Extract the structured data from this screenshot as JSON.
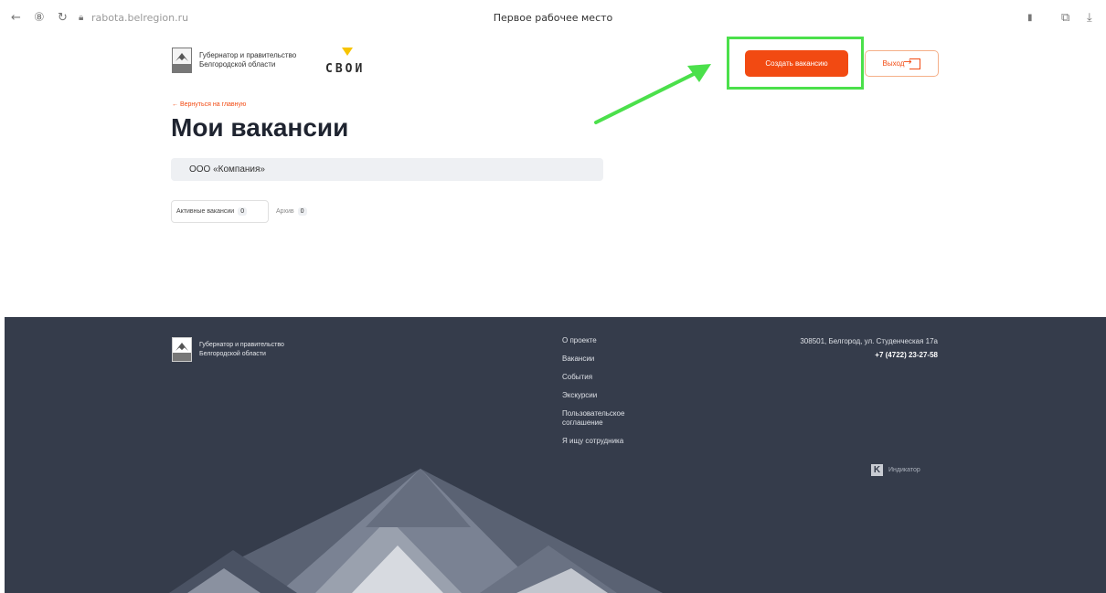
{
  "browser": {
    "url": "rabota.belregion.ru",
    "title": "Первое рабочее место"
  },
  "header": {
    "gov_logo_line1": "Губернатор и правительство",
    "gov_logo_line2": "Белгородской области",
    "svoi_logo_text": "СВОИ",
    "create_button": "Создать вакансию",
    "exit_button": "Выход"
  },
  "main": {
    "back_link": "← Вернуться на главную",
    "title": "Мои вакансии",
    "company": "ООО «Компания»",
    "tabs": [
      {
        "label": "Активные вакансии",
        "count": "0"
      },
      {
        "label": "Архив",
        "count": "0"
      }
    ]
  },
  "footer": {
    "logo_line1": "Губернатор и правительство",
    "logo_line2": "Белгородской области",
    "nav": [
      "О проекте",
      "Вакансии",
      "События",
      "Экскурсии",
      "Пользовательское соглашение",
      "Я ищу сотрудника"
    ],
    "address": "308501, Белгород, ул. Студенческая 17а",
    "phone": "+7 (4722) 23-27-58",
    "indicator": "Индикатор"
  },
  "colors": {
    "accent": "#f24a12",
    "footer_bg": "#353c4b",
    "highlight": "#4be04b"
  }
}
